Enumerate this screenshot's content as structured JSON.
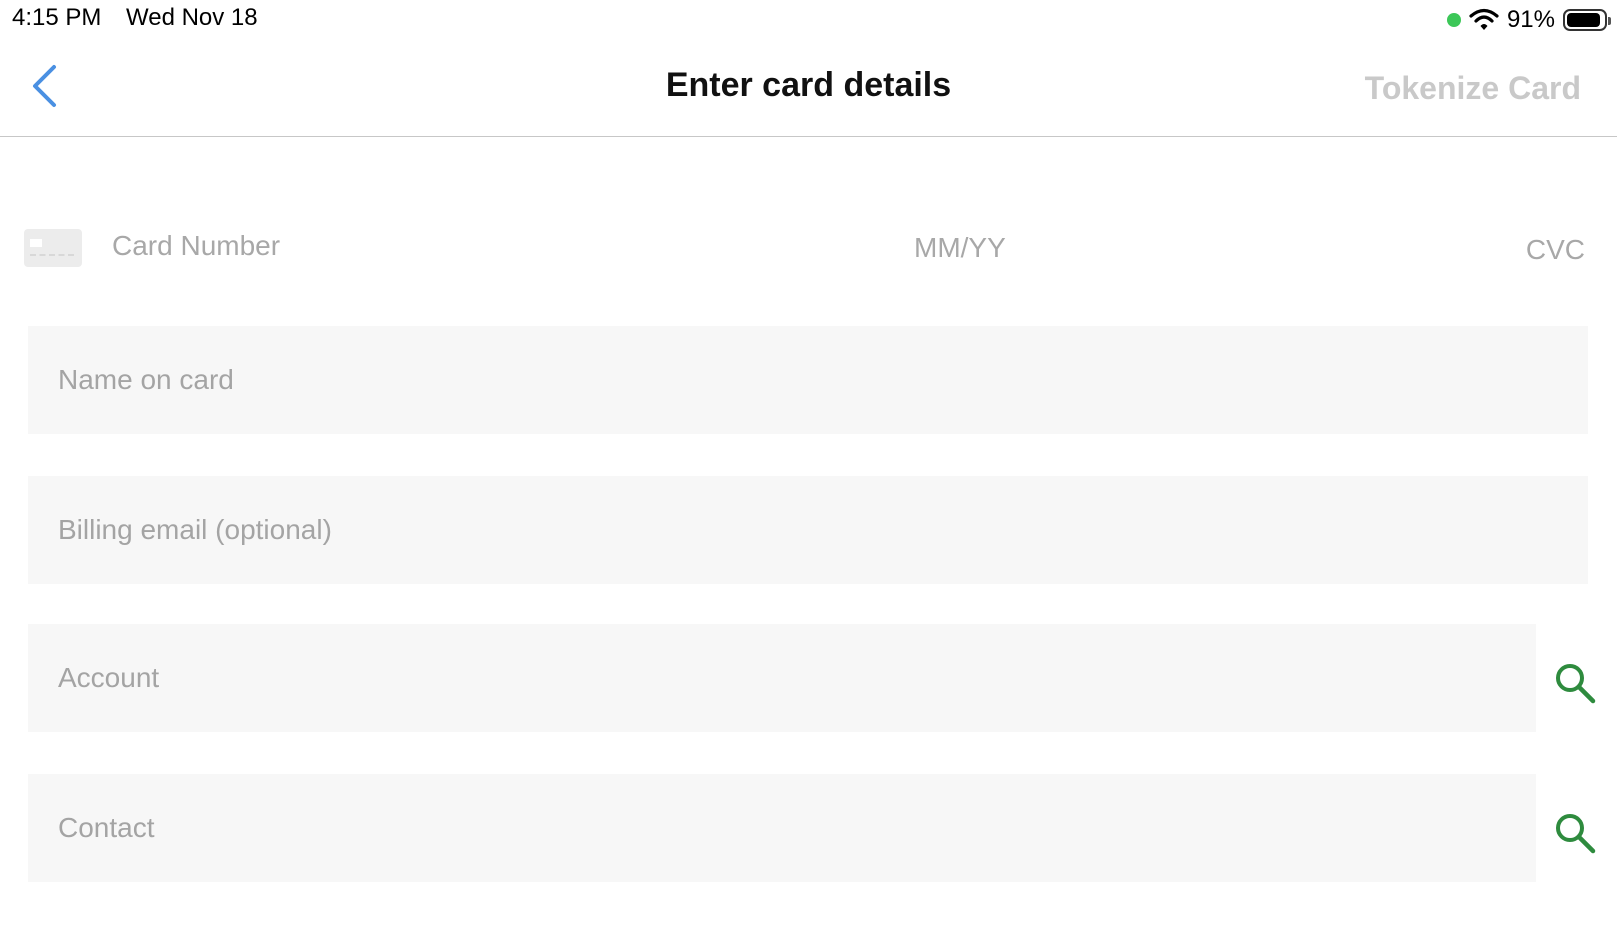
{
  "status_bar": {
    "time": "4:15 PM",
    "date": "Wed Nov 18",
    "battery_percent": "91%",
    "battery_level": 0.91,
    "icons": [
      "green-dot-indicator",
      "wifi-icon",
      "battery-icon"
    ]
  },
  "nav": {
    "back_icon": "chevron-left-icon",
    "title": "Enter card details",
    "action_label": "Tokenize Card"
  },
  "colors": {
    "accent_blue": "#4a90e2",
    "search_green": "#2e8b3e",
    "disabled_text": "#c9c9c9",
    "placeholder_text": "#a4a4a4",
    "field_background": "#f7f7f7"
  },
  "card_input": {
    "icon": "credit-card-icon",
    "number_placeholder": "Card Number",
    "expiry_placeholder": "MM/YY",
    "cvc_placeholder": "CVC"
  },
  "form": {
    "name_placeholder": "Name on card",
    "email_placeholder": "Billing email (optional)",
    "account_placeholder": "Account",
    "contact_placeholder": "Contact",
    "search_icon": "search-icon"
  }
}
